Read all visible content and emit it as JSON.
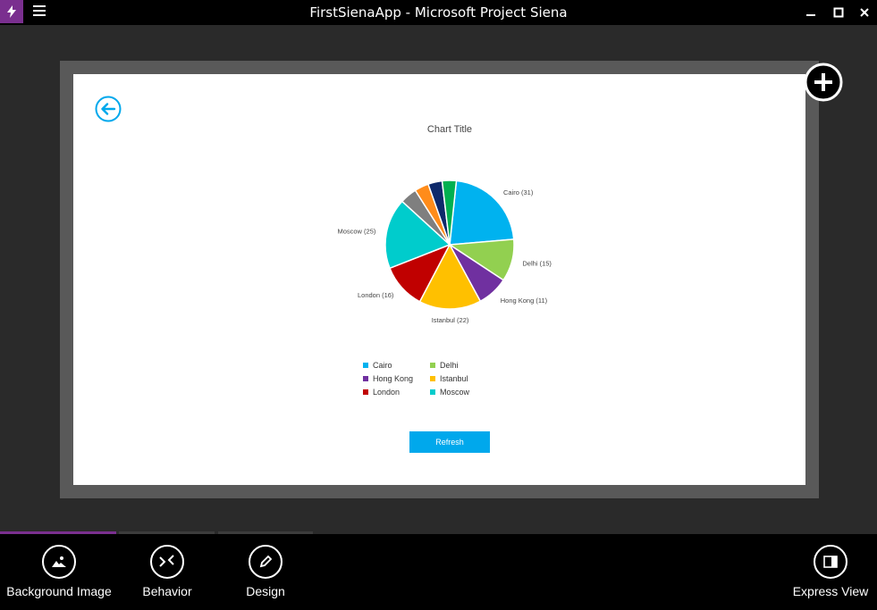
{
  "window": {
    "title": "FirstSienaApp - Microsoft Project Siena",
    "accent": "#7a2f8f"
  },
  "canvas": {
    "chart_title": "Chart Title",
    "refresh_label": "Refresh"
  },
  "appbar": {
    "background_image": "Background Image",
    "behavior": "Behavior",
    "design": "Design",
    "express_view": "Express View"
  },
  "chart_data": {
    "type": "pie",
    "title": "Chart Title",
    "slices": [
      {
        "name": "Cairo",
        "value": 31,
        "color": "#00b2ef",
        "labeled": true
      },
      {
        "name": "Delhi",
        "value": 15,
        "color": "#92d050",
        "labeled": true
      },
      {
        "name": "Hong Kong",
        "value": 11,
        "color": "#7030a0",
        "labeled": true
      },
      {
        "name": "Istanbul",
        "value": 22,
        "color": "#ffc000",
        "labeled": true
      },
      {
        "name": "London",
        "value": 16,
        "color": "#c00000",
        "labeled": true
      },
      {
        "name": "Moscow",
        "value": 25,
        "color": "#00cccc",
        "labeled": true
      },
      {
        "name": "",
        "value": 6,
        "color": "#7f7f7f",
        "labeled": false
      },
      {
        "name": "",
        "value": 5,
        "color": "#ff8c1a",
        "labeled": false
      },
      {
        "name": "",
        "value": 5,
        "color": "#0e2a6b",
        "labeled": false
      },
      {
        "name": "",
        "value": 5,
        "color": "#00b050",
        "labeled": false
      }
    ],
    "legend": [
      "Cairo",
      "Delhi",
      "Hong Kong",
      "Istanbul",
      "London",
      "Moscow"
    ],
    "legend_placement": "bottom"
  }
}
